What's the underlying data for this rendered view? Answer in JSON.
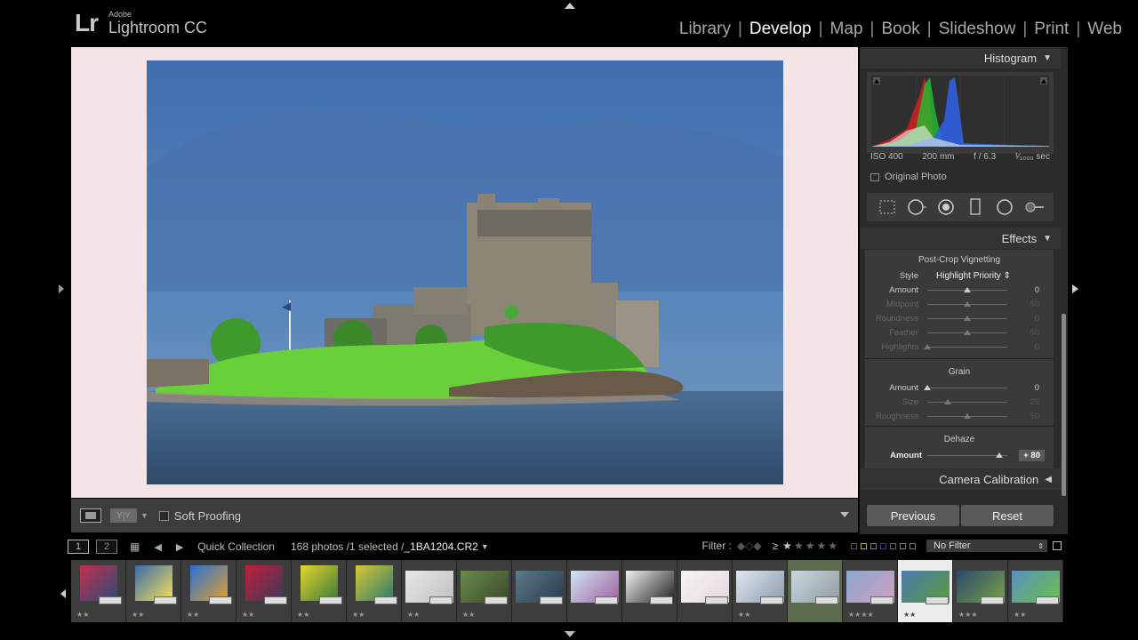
{
  "app": {
    "vendor": "Adobe",
    "logo_mark": "Lr",
    "name": "Lightroom CC"
  },
  "modules": [
    "Library",
    "Develop",
    "Map",
    "Book",
    "Slideshow",
    "Print",
    "Web"
  ],
  "active_module": "Develop",
  "toolbar": {
    "view_compare": "Y|Y",
    "soft_proofing_label": "Soft Proofing"
  },
  "histogram": {
    "header": "Histogram",
    "iso": "ISO 400",
    "focal": "200 mm",
    "aperture": "f / 6.3",
    "shutter": "¹⁄₁₀₀₀ sec",
    "original_photo_label": "Original Photo"
  },
  "effects": {
    "header": "Effects",
    "vignette_title": "Post-Crop Vignetting",
    "style_label": "Style",
    "style_value": "Highlight Priority",
    "vignette_rows": [
      {
        "label": "Amount",
        "value": "0",
        "pos": 0.5,
        "dim": false
      },
      {
        "label": "Midpoint",
        "value": "50",
        "pos": 0.5,
        "dim": true
      },
      {
        "label": "Roundness",
        "value": "0",
        "pos": 0.5,
        "dim": true
      },
      {
        "label": "Feather",
        "value": "50",
        "pos": 0.5,
        "dim": true
      },
      {
        "label": "Highlights",
        "value": "0",
        "pos": 0.0,
        "dim": true
      }
    ],
    "grain_title": "Grain",
    "grain_rows": [
      {
        "label": "Amount",
        "value": "0",
        "pos": 0.0,
        "dim": false
      },
      {
        "label": "Size",
        "value": "25",
        "pos": 0.25,
        "dim": true
      },
      {
        "label": "Roughness",
        "value": "50",
        "pos": 0.5,
        "dim": true
      }
    ],
    "dehaze_title": "Dehaze",
    "dehaze_row": {
      "label": "Amount",
      "value": "+ 80",
      "pos": 0.9
    }
  },
  "camera_calibration_header": "Camera Calibration",
  "buttons": {
    "previous": "Previous",
    "reset": "Reset"
  },
  "filmstrip_bar": {
    "screen1": "1",
    "screen2": "2",
    "source": "Quick Collection",
    "count": "168 photos /1 selected /",
    "filename": "_1BA1204.CR2",
    "filter_label": "Filter :",
    "rating_op": "≥",
    "no_filter": "No Filter"
  },
  "filmstrip": [
    {
      "stars": "★★",
      "colors": [
        "#c2304a",
        "#2b4a7a"
      ],
      "wide": false
    },
    {
      "stars": "★★",
      "colors": [
        "#3b6aa8",
        "#f2e15a"
      ],
      "wide": false
    },
    {
      "stars": "★★",
      "colors": [
        "#2a6fd1",
        "#e0a033"
      ],
      "wide": false
    },
    {
      "stars": "★★",
      "colors": [
        "#c21e3a",
        "#3a3a5a"
      ],
      "wide": false
    },
    {
      "stars": "★★",
      "colors": [
        "#e6d62c",
        "#3a7a3a"
      ],
      "wide": false
    },
    {
      "stars": "★★",
      "colors": [
        "#d9c835",
        "#2b7b6b"
      ],
      "wide": false
    },
    {
      "stars": "★★",
      "colors": [
        "#e8e8e8",
        "#c0c0c0"
      ],
      "wide": true
    },
    {
      "stars": "★★",
      "colors": [
        "#6a8a4a",
        "#3a4a2a"
      ],
      "wide": true
    },
    {
      "stars": "",
      "colors": [
        "#5a7a8a",
        "#2a3a4a"
      ],
      "wide": true
    },
    {
      "stars": "",
      "colors": [
        "#d0e4f0",
        "#a060a0"
      ],
      "wide": true
    },
    {
      "stars": "",
      "colors": [
        "#f0f0f0",
        "#202020"
      ],
      "wide": true
    },
    {
      "stars": "",
      "colors": [
        "#f4f4f4",
        "#e8d8dc"
      ],
      "wide": true
    },
    {
      "stars": "★★",
      "colors": [
        "#e0e8f0",
        "#8a9aaa"
      ],
      "wide": true
    },
    {
      "stars": "",
      "colors": [
        "#c8d8e0",
        "#909aa0"
      ],
      "wide": true,
      "sel": true
    },
    {
      "stars": "★★★★",
      "colors": [
        "#8aa8d0",
        "#d0a0c0"
      ],
      "wide": true
    },
    {
      "stars": "★★",
      "colors": [
        "#4a7ab0",
        "#5a9a3a"
      ],
      "wide": true,
      "active": true
    },
    {
      "stars": "★★★",
      "colors": [
        "#2a4a6a",
        "#7aa04a"
      ],
      "wide": true
    },
    {
      "stars": "★★",
      "colors": [
        "#5a90c0",
        "#6ac04a"
      ],
      "wide": true
    }
  ]
}
